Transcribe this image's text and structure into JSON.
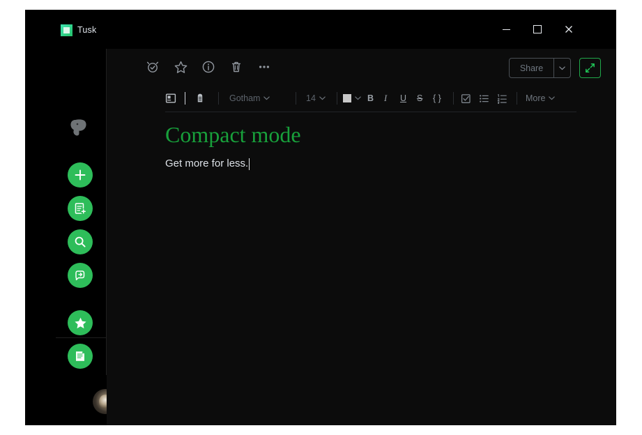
{
  "window": {
    "title": "Tusk",
    "app_icon": "tusk-app-icon",
    "controls": {
      "minimize": "minimize-icon",
      "maximize": "maximize-icon",
      "close": "close-icon"
    }
  },
  "sidebar": {
    "logo": "evernote-elephant-logo",
    "items": [
      {
        "name": "new-note",
        "icon": "plus-icon"
      },
      {
        "name": "new-notebook",
        "icon": "note-plus-icon"
      },
      {
        "name": "search",
        "icon": "magnifier-icon"
      },
      {
        "name": "sync",
        "icon": "sync-arrow-icon"
      },
      {
        "name": "shortcuts",
        "icon": "star-filled-icon"
      },
      {
        "name": "notes",
        "icon": "document-lines-icon"
      }
    ],
    "avatar": "user-avatar"
  },
  "note_toolbar": {
    "items": [
      {
        "name": "reminder",
        "icon": "alarm-clock-check-icon"
      },
      {
        "name": "favorite",
        "icon": "star-outline-icon"
      },
      {
        "name": "info",
        "icon": "info-circle-icon"
      },
      {
        "name": "delete",
        "icon": "trash-icon"
      },
      {
        "name": "more-actions",
        "icon": "ellipsis-icon"
      }
    ],
    "share_label": "Share",
    "share_caret": "⌄",
    "expand_icon": "expand-diagonal-icon"
  },
  "format_bar": {
    "note_view_icon": "note-panel-icon",
    "tag_icon": "tag-icon",
    "font_family": "Gotham",
    "font_size": "14",
    "color_swatch": "#c8c8c8",
    "bold": "B",
    "italic": "I",
    "underline": "U",
    "strikethrough": "S",
    "code": "{ }",
    "todo_icon": "checkbox-list-icon",
    "bullet_icon": "bullet-list-icon",
    "number_icon": "numbered-list-icon",
    "more_label": "More",
    "caret": "⌄"
  },
  "note": {
    "title": "Compact mode",
    "body": "Get more for less."
  },
  "colors": {
    "accent_green": "#2ebd5a",
    "title_green": "#18a03b",
    "expand_border": "#20a84a",
    "window_bg": "#000000",
    "editor_bg": "#0c0c0c"
  }
}
